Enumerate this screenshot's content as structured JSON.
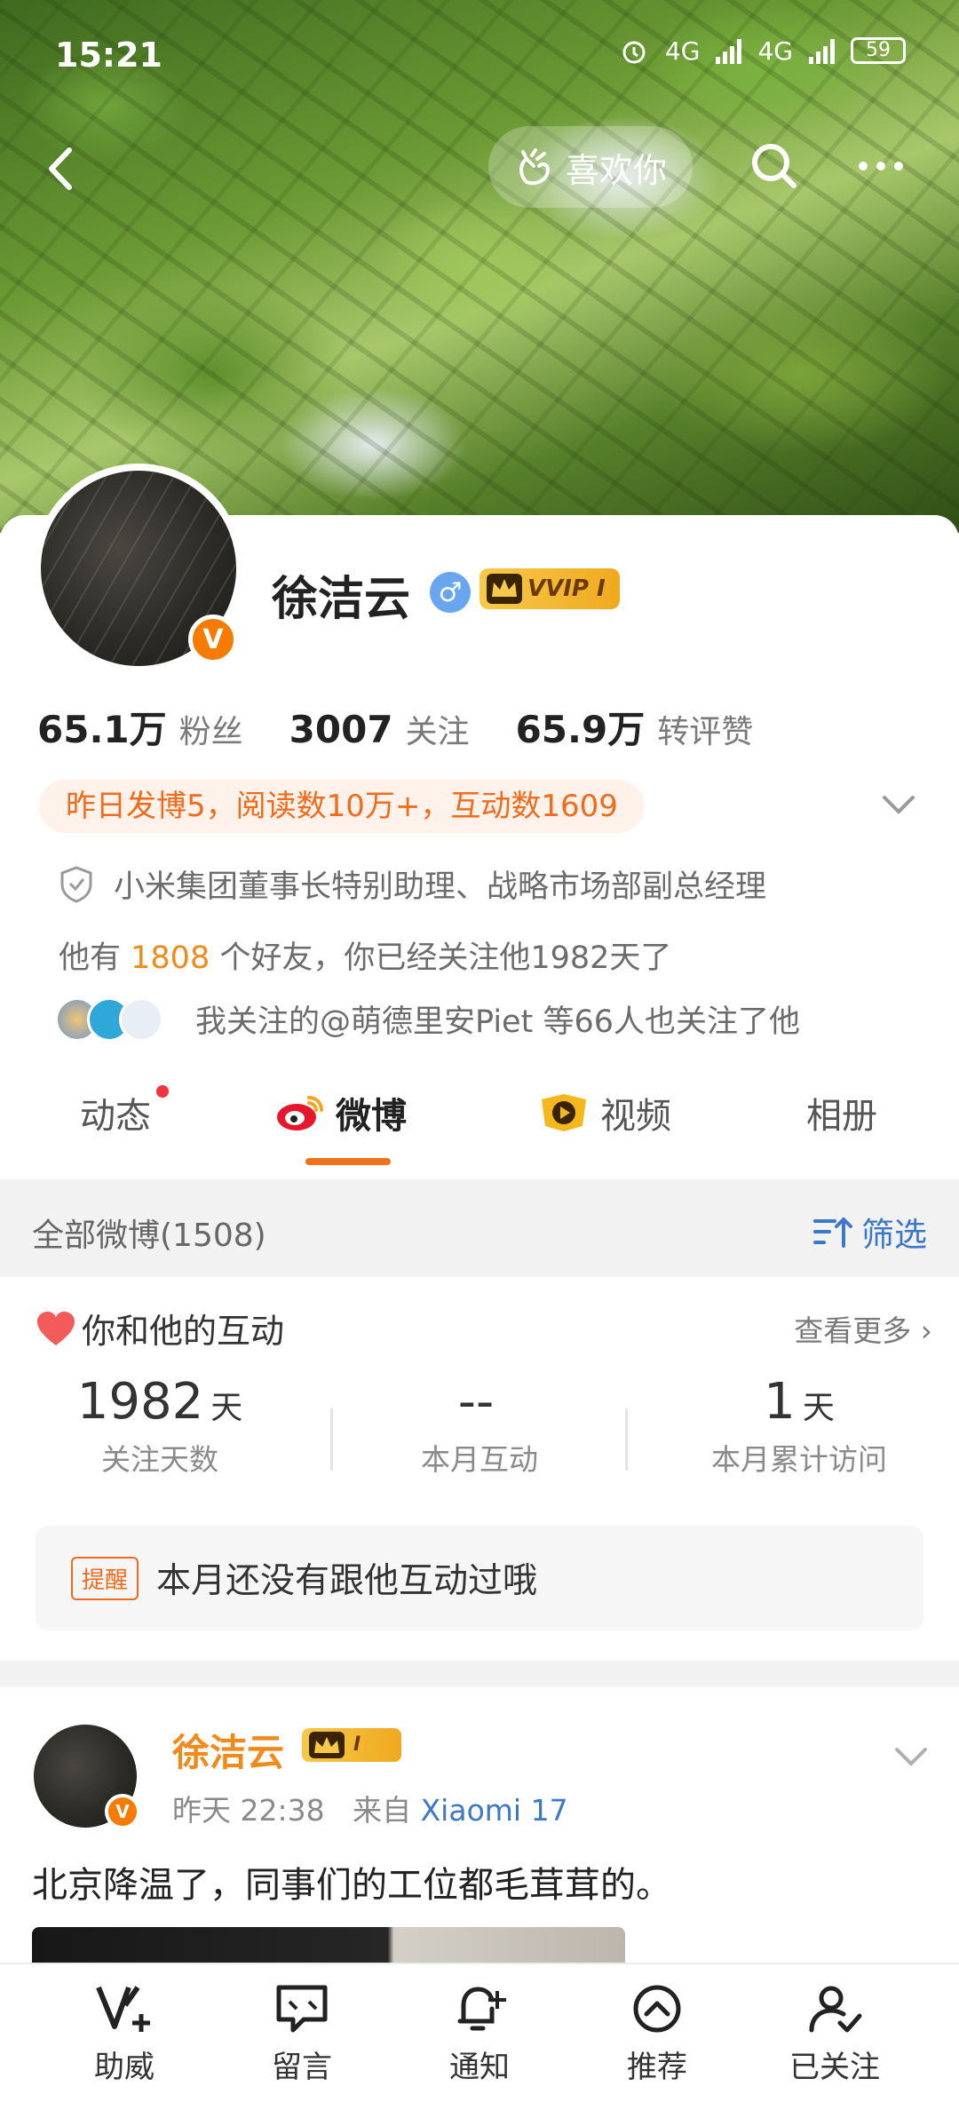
{
  "status_bar": {
    "time": "15:21",
    "net1": "4G",
    "net2": "4G",
    "battery": "59"
  },
  "topnav": {
    "like_label": "喜欢你"
  },
  "profile": {
    "name": "徐洁云",
    "vip_label": "VVIP I",
    "stats": [
      {
        "value": "65.1万",
        "label": "粉丝"
      },
      {
        "value": "3007",
        "label": "关注"
      },
      {
        "value": "65.9万",
        "label": "转评赞"
      }
    ],
    "activity": "昨日发博5，阅读数10万+，互动数1609",
    "verification": "小米集团董事长特别助理、战略市场部副总经理",
    "friends_prefix": "他有 ",
    "friends_count": "1808",
    "friends_suffix": " 个好友，你已经关注他1982天了",
    "mutual_text": "我关注的@萌德里安Piet 等66人也关注了他"
  },
  "tabs": [
    {
      "label": "动态"
    },
    {
      "label": "微博"
    },
    {
      "label": "视频"
    },
    {
      "label": "相册"
    }
  ],
  "filter": {
    "left": "全部微博(1508)",
    "right": "筛选"
  },
  "interaction": {
    "title": "你和他的互动",
    "more": "查看更多",
    "cells": [
      {
        "value": "1982",
        "unit": "天",
        "label": "关注天数"
      },
      {
        "value": "--",
        "unit": "",
        "label": "本月互动"
      },
      {
        "value": "1",
        "unit": "天",
        "label": "本月累计访问"
      }
    ],
    "tip_tag": "提醒",
    "tip_text": "本月还没有跟他互动过哦"
  },
  "post": {
    "name": "徐洁云",
    "vip_label": "I",
    "time": "昨天 22:38",
    "from": "来自 ",
    "source": "Xiaomi 17",
    "text": "北京降温了，同事们的工位都毛茸茸的。"
  },
  "bottom_bar": [
    {
      "label": "助威"
    },
    {
      "label": "留言"
    },
    {
      "label": "通知"
    },
    {
      "label": "推荐"
    },
    {
      "label": "已关注"
    }
  ],
  "colors": {
    "accent": "#f2711c",
    "link": "#3c78c7",
    "badge": "#f57c00"
  }
}
